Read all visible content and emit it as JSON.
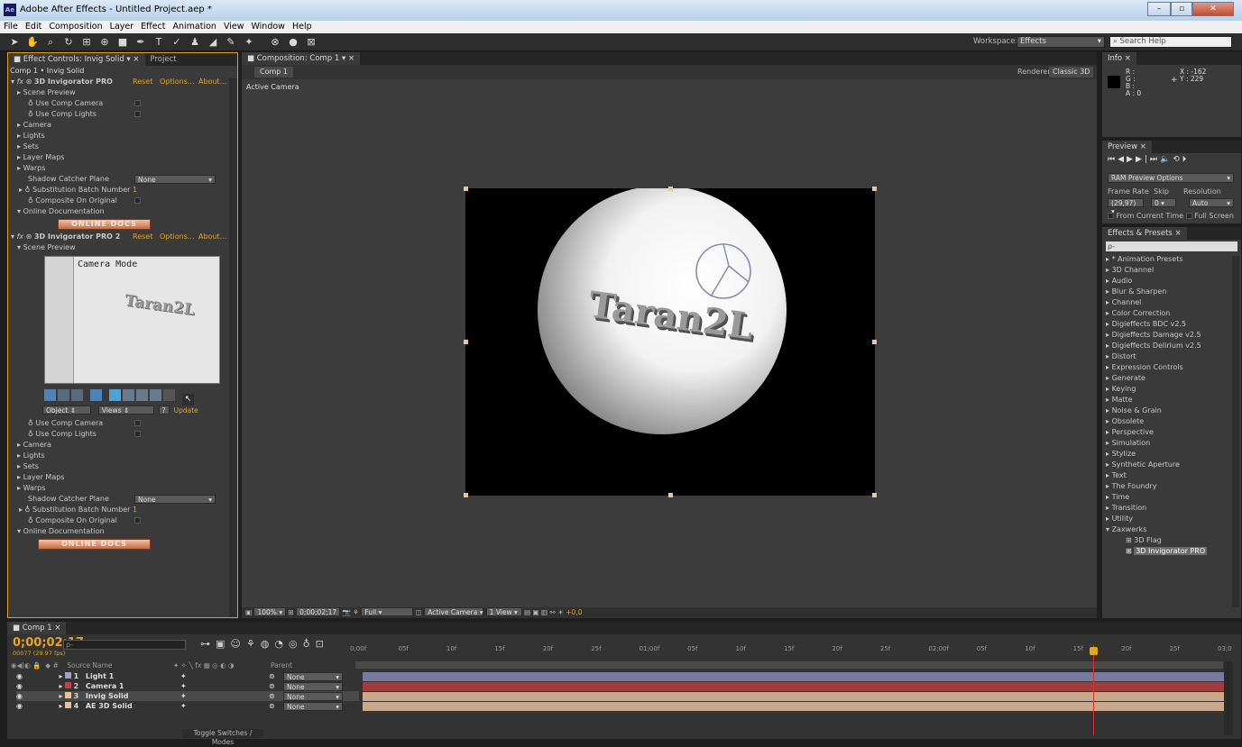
{
  "window": {
    "title": "Adobe After Effects - Untitled Project.aep *",
    "app_icon": "Ae",
    "buttons": [
      "–",
      "▫",
      "✕"
    ]
  },
  "menu": [
    "File",
    "Edit",
    "Composition",
    "Layer",
    "Effect",
    "Animation",
    "View",
    "Window",
    "Help"
  ],
  "toolbar": {
    "workspace_label": "Workspace:",
    "workspace_value": "Effects",
    "search_placeholder": "Search Help"
  },
  "effect_controls": {
    "tab_label": "Effect Controls: Invig Solid",
    "project_tab": "Project",
    "breadcrumb": "Comp 1 • Invig Solid",
    "effect1": {
      "name": "3D Invigorator PRO",
      "reset": "Reset",
      "options": "Options...",
      "about": "About...",
      "rows": [
        "Scene Preview",
        "Use Comp Camera",
        "Use Comp Lights",
        "Camera",
        "Lights",
        "Sets",
        "Layer Maps",
        "Warps"
      ],
      "shadow_label": "Shadow Catcher Plane",
      "shadow_value": "None",
      "batch_label": "Substitution Batch Number",
      "batch_value": "1",
      "composite_label": "Composite On Original",
      "docs_label": "Online Documentation",
      "docs_button": "ONLINE DOCS"
    },
    "effect2": {
      "name": "3D Invigorator PRO 2",
      "reset": "Reset",
      "options": "Options...",
      "about": "About...",
      "scene_preview": "Scene Preview",
      "preview_mode": "Camera Mode",
      "preview_text": "Taran2L",
      "object_label": "Object",
      "views_label": "Views",
      "q_label": "?",
      "update_label": "Update",
      "rows": [
        "Use Comp Camera",
        "Use Comp Lights",
        "Camera",
        "Lights",
        "Sets",
        "Layer Maps",
        "Warps"
      ],
      "shadow_label": "Shadow Catcher Plane",
      "shadow_value": "None",
      "batch_label": "Substitution Batch Number",
      "batch_value": "1",
      "composite_label": "Composite On Original",
      "docs_label": "Online Documentation",
      "docs_button": "ONLINE DOCS"
    }
  },
  "composition": {
    "tab_label": "Composition: Comp 1",
    "comp_tab": "Comp 1",
    "renderer_label": "Renderer:",
    "renderer_value": "Classic 3D",
    "view_label": "Active Camera",
    "canvas_text": "Taran2L",
    "footer": {
      "zoom": "100%",
      "timecode": "0;00;02;17",
      "resolution": "Full",
      "camera": "Active Camera",
      "views": "1 View",
      "exposure": "+0,0"
    }
  },
  "info": {
    "tab": "Info",
    "r": "R :",
    "g": "G :",
    "b": "B :",
    "a": "A : 0",
    "x": "X : -162",
    "y": "Y : 229"
  },
  "preview": {
    "tab": "Preview",
    "ram": "RAM Preview Options",
    "frame_rate_label": "Frame Rate",
    "skip_label": "Skip",
    "resolution_label": "Resolution",
    "frame_rate": "(29,97)",
    "skip": "0",
    "resolution": "Auto",
    "from_current": "From Current Time",
    "full_screen": "Full Screen"
  },
  "effects_presets": {
    "tab": "Effects & Presets",
    "search_placeholder": "ρ-",
    "items": [
      "* Animation Presets",
      "3D Channel",
      "Audio",
      "Blur & Sharpen",
      "Channel",
      "Color Correction",
      "Digieffects BDC v2.5",
      "Digieffects Damage v2.5",
      "Digieffects Delirium v2.5",
      "Distort",
      "Expression Controls",
      "Generate",
      "Keying",
      "Matte",
      "Noise & Grain",
      "Obsolete",
      "Perspective",
      "Simulation",
      "Stylize",
      "Synthetic Aperture",
      "Text",
      "The Foundry",
      "Time",
      "Transition",
      "Utility",
      "Zaxwerks"
    ],
    "sub_items": [
      "3D Flag",
      "3D Invigorator PRO"
    ]
  },
  "timeline": {
    "tab": "Comp 1",
    "timecode": "0;00;02;17",
    "fps": "00077 (29.97 fps)",
    "search_placeholder": "ρ-",
    "header": {
      "source_name": "Source Name",
      "parent": "Parent",
      "hash": "#"
    },
    "ruler": [
      "0;00f",
      "05f",
      "10f",
      "15f",
      "20f",
      "25f",
      "01;00f",
      "05f",
      "10f",
      "15f",
      "20f",
      "25f",
      "02;00f",
      "05f",
      "10f",
      "15f",
      "20f",
      "25f",
      "03;0"
    ],
    "layers": [
      {
        "num": "1",
        "name": "Light 1",
        "parent": "None",
        "color": "#a7a0c9",
        "bar": "#7a7a9e"
      },
      {
        "num": "2",
        "name": "Camera 1",
        "parent": "None",
        "color": "#c54040",
        "bar": "#a03c3c"
      },
      {
        "num": "3",
        "name": "Invig Solid",
        "parent": "None",
        "color": "#e6c3a0",
        "bar": "#c8a888"
      },
      {
        "num": "4",
        "name": "AE 3D Solid",
        "parent": "None",
        "color": "#e6c3a0",
        "bar": "#c8a888"
      }
    ],
    "toggle_label": "Toggle Switches / Modes"
  }
}
